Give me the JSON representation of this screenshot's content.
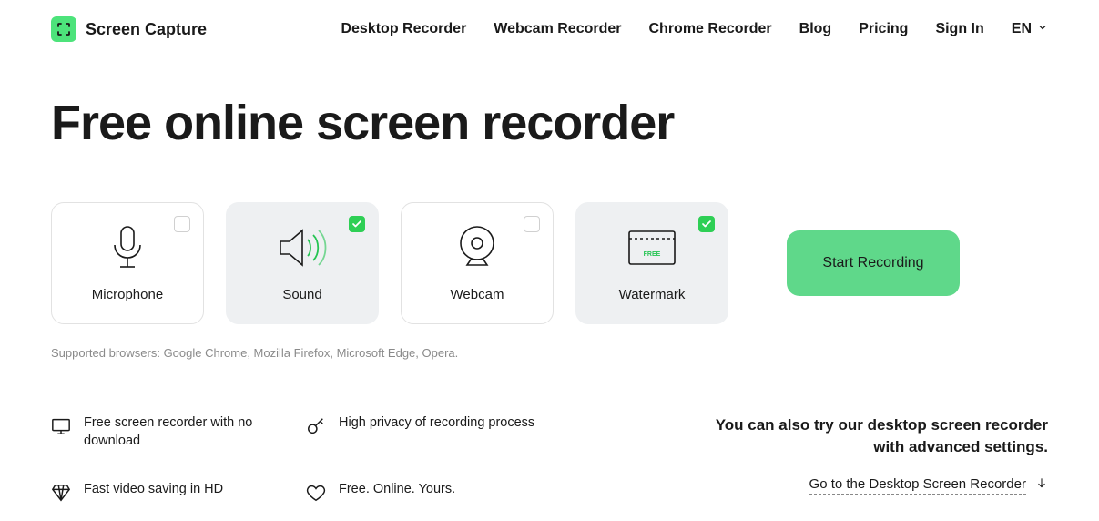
{
  "brand": {
    "name": "Screen Capture"
  },
  "nav": {
    "items": [
      {
        "label": "Desktop Recorder"
      },
      {
        "label": "Webcam Recorder"
      },
      {
        "label": "Chrome Recorder"
      },
      {
        "label": "Blog"
      },
      {
        "label": "Pricing"
      },
      {
        "label": "Sign In"
      }
    ],
    "language": "EN"
  },
  "hero": {
    "headline": "Free online screen recorder",
    "options": [
      {
        "label": "Microphone",
        "checked": false
      },
      {
        "label": "Sound",
        "checked": true
      },
      {
        "label": "Webcam",
        "checked": false
      },
      {
        "label": "Watermark",
        "checked": true
      }
    ],
    "start_label": "Start Recording",
    "supported_label": "Supported browsers: Google Chrome, Mozilla Firefox, Microsoft Edge, Opera."
  },
  "features": [
    {
      "text": "Free screen recorder with no download"
    },
    {
      "text": "High privacy of recording process"
    },
    {
      "text": "Fast video saving in HD"
    },
    {
      "text": "Free. Online. Yours."
    }
  ],
  "cta": {
    "text": "You can also try our desktop screen recorder with advanced settings.",
    "link_label": "Go to the Desktop Screen Recorder"
  }
}
